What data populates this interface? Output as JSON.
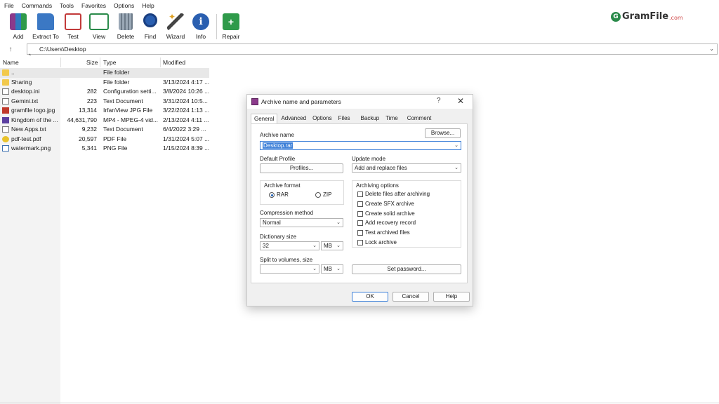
{
  "menu": [
    "File",
    "Commands",
    "Tools",
    "Favorites",
    "Options",
    "Help"
  ],
  "logo": {
    "mark": "G",
    "text": "GramFile",
    "suffix": ".com"
  },
  "toolbar": [
    {
      "label": "Add",
      "icon": "add-archive-icon",
      "color": "#7a3b8f"
    },
    {
      "label": "Extract To",
      "icon": "extract-folder-icon",
      "color": "#3b78c4"
    },
    {
      "label": "Test",
      "icon": "test-checklist-icon",
      "color": "#c23a3a"
    },
    {
      "label": "View",
      "icon": "view-book-icon",
      "color": "#2a8a4a"
    },
    {
      "label": "Delete",
      "icon": "delete-trash-icon",
      "color": "#7a8a9a"
    },
    {
      "label": "Find",
      "icon": "find-magnifier-icon",
      "color": "#2a5fb0"
    },
    {
      "label": "Wizard",
      "icon": "wizard-wand-icon",
      "color": "#e0a020"
    },
    {
      "label": "Info",
      "icon": "info-icon",
      "color": "#2a5fb0"
    },
    {
      "label": "Repair",
      "icon": "repair-kit-icon",
      "color": "#2f9a4a"
    }
  ],
  "address": {
    "path": "C:\\Users\\Desktop"
  },
  "columns": {
    "name": "Name",
    "size": "Size",
    "type": "Type",
    "modified": "Modified"
  },
  "files": [
    {
      "name": "..",
      "size": "",
      "type": "File folder",
      "modified": "",
      "icon": "folder-icon"
    },
    {
      "name": "Sharing",
      "size": "",
      "type": "File folder",
      "modified": "3/13/2024 4:17 ...",
      "icon": "folder-icon"
    },
    {
      "name": "desktop.ini",
      "size": "282",
      "type": "Configuration setti...",
      "modified": "3/8/2024 10:26 ...",
      "icon": "document-icon"
    },
    {
      "name": "Gemini.txt",
      "size": "223",
      "type": "Text Document",
      "modified": "3/31/2024 10:5...",
      "icon": "document-icon"
    },
    {
      "name": "gramfile logo.jpg",
      "size": "13,314",
      "type": "IrfanView JPG File",
      "modified": "3/22/2024 1:13 ...",
      "icon": "image-icon"
    },
    {
      "name": "Kingdom of the ...",
      "size": "44,631,790",
      "type": "MP4 - MPEG-4 vid...",
      "modified": "2/13/2024 4:11 ...",
      "icon": "video-icon"
    },
    {
      "name": "New Apps.txt",
      "size": "9,232",
      "type": "Text Document",
      "modified": "6/4/2022 3:29 ...",
      "icon": "document-icon"
    },
    {
      "name": "pdf-test.pdf",
      "size": "20,597",
      "type": "PDF File",
      "modified": "1/31/2024 5:07 ...",
      "icon": "pdf-icon"
    },
    {
      "name": "watermark.png",
      "size": "5,341",
      "type": "PNG File",
      "modified": "1/15/2024 8:39 ...",
      "icon": "png-icon"
    }
  ],
  "dialog": {
    "title": "Archive name and parameters",
    "help": "?",
    "close": "✕",
    "tabs": [
      "General",
      "Advanced",
      "Options",
      "Files",
      "Backup",
      "Time",
      "Comment"
    ],
    "archive_name_label": "Archive name",
    "browse": "Browse...",
    "archive_name": "Desktop.rar",
    "default_profile_label": "Default Profile",
    "profiles": "Profiles...",
    "update_mode_label": "Update mode",
    "update_mode": "Add and replace files",
    "archive_format_label": "Archive format",
    "format_rar": "RAR",
    "format_zip": "ZIP",
    "compression_label": "Compression method",
    "compression": "Normal",
    "dictionary_label": "Dictionary size",
    "dictionary": "32",
    "dictionary_unit": "MB",
    "split_label": "Split to volumes, size",
    "split_value": "",
    "split_unit": "MB",
    "archiving_options_label": "Archiving options",
    "options": [
      "Delete files after archiving",
      "Create SFX archive",
      "Create solid archive",
      "Add recovery record",
      "Test archived files",
      "Lock archive"
    ],
    "set_password": "Set password...",
    "ok": "OK",
    "cancel": "Cancel",
    "help_btn": "Help"
  }
}
